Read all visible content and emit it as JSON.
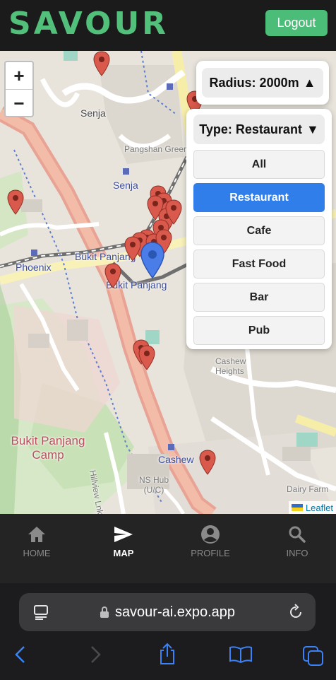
{
  "app": {
    "brand": "SAVOUR",
    "logout_label": "Logout"
  },
  "map": {
    "zoom_in": "+",
    "zoom_out": "−",
    "attribution": "Leaflet",
    "labels": {
      "senja": "Senja",
      "pangshan_green": "Pangshan Green",
      "senja_station": "Senja",
      "bukit_panjang_road": "Bukit Panjang",
      "bukit_panjang_station": "Bukit Panjang",
      "phoenix": "Phoenix",
      "cashew_heights": "Cashew Heights",
      "bukit_panjang_camp": "Bukit Panjang Camp",
      "cashew": "Cashew",
      "ns_hub": "NS Hub (U/C)",
      "dairy_farm": "Dairy Farm",
      "hillview_link": "Hillview Lnk"
    }
  },
  "filters": {
    "radius_label": "Radius: 2000m",
    "radius_arrow": "▲",
    "type_label": "Type: Restaurant",
    "type_arrow": "▼",
    "options": [
      "All",
      "Restaurant",
      "Cafe",
      "Fast Food",
      "Bar",
      "Pub"
    ],
    "selected": "Restaurant"
  },
  "tabs": [
    {
      "label": "HOME",
      "icon": "home-icon"
    },
    {
      "label": "MAP",
      "icon": "send-icon"
    },
    {
      "label": "PROFILE",
      "icon": "account-icon"
    },
    {
      "label": "INFO",
      "icon": "search-icon"
    }
  ],
  "active_tab": "MAP",
  "browser": {
    "url": "savour-ai.expo.app"
  },
  "colors": {
    "brand": "#52c07a",
    "logout_bg": "#4bbd78",
    "selected_option": "#2f7ee9",
    "pin_red": "#d9594c",
    "pin_blue": "#4a7de8"
  }
}
